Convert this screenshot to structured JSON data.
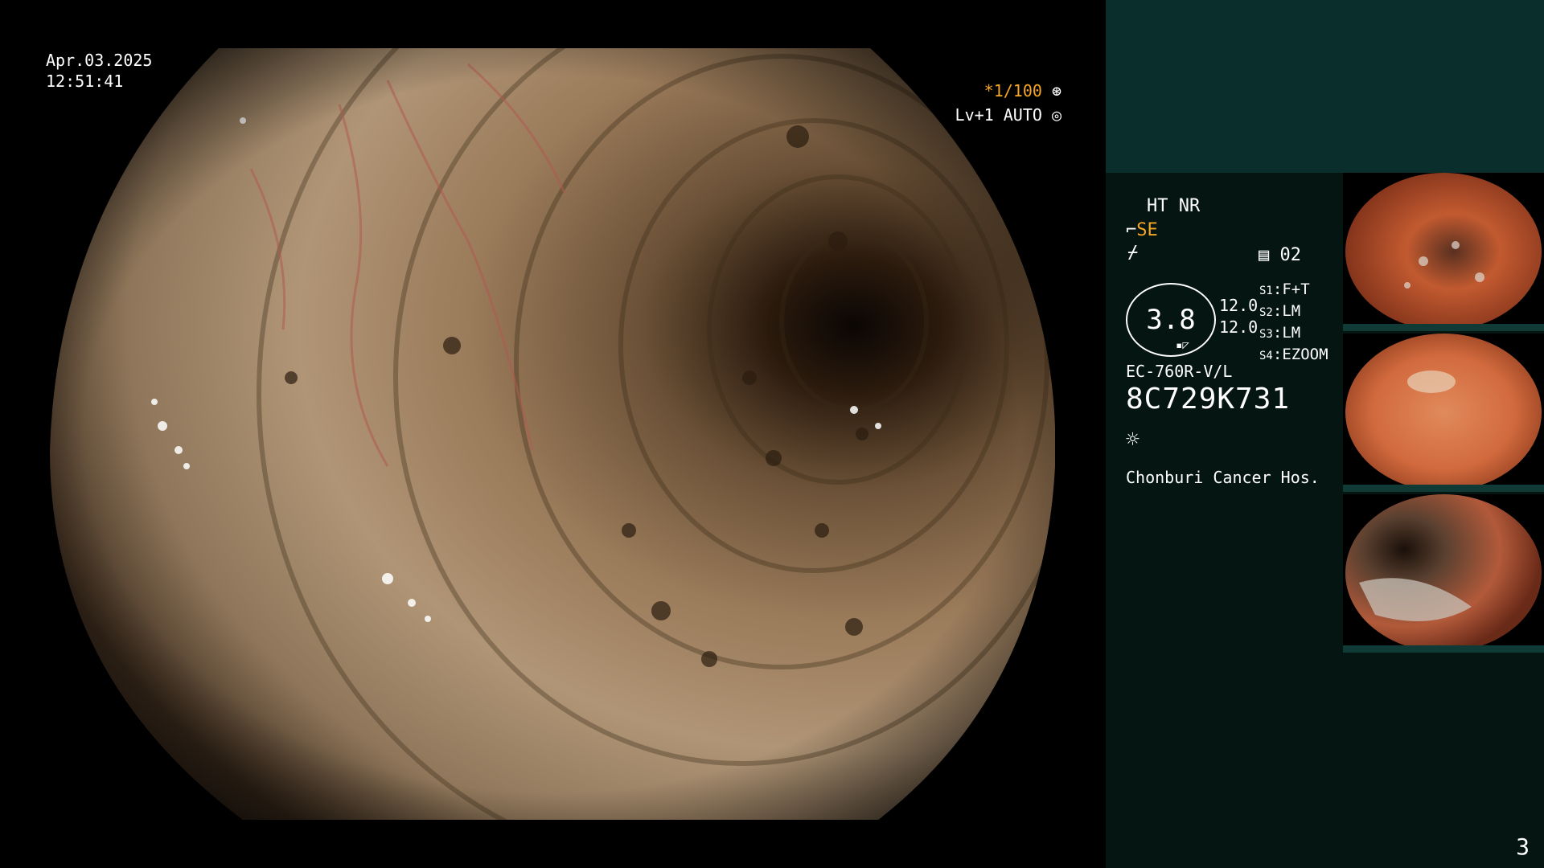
{
  "overlay": {
    "date": "Apr.03.2025",
    "time": "12:51:41",
    "shutter": "*1/100",
    "level": "Lv+1 AUTO"
  },
  "panel": {
    "modes": "HT NR",
    "se_label": "SE",
    "record_number": "02",
    "magnification": "3.8",
    "value_1": "12.0",
    "value_2": "12.0",
    "switches": [
      {
        "key": "S1",
        "value": "F+T"
      },
      {
        "key": "S2",
        "value": "LM"
      },
      {
        "key": "S3",
        "value": "LM"
      },
      {
        "key": "S4",
        "value": "EZOOM"
      }
    ],
    "scope_model": "EC-760R-V/L",
    "serial": "8C729K731",
    "hospital": "Chonburi Cancer Hos."
  },
  "page_number": "3",
  "colors": {
    "accent_orange": "#f5a623",
    "panel_bg": "#041512",
    "panel_top_bg": "#0a2e2c"
  },
  "icons": [
    "aperture-icon",
    "iris-icon",
    "structure-enhance-icon",
    "color-enhance-icon",
    "memory-card-icon",
    "light-brightness-icon",
    "scope-tip-icon"
  ]
}
